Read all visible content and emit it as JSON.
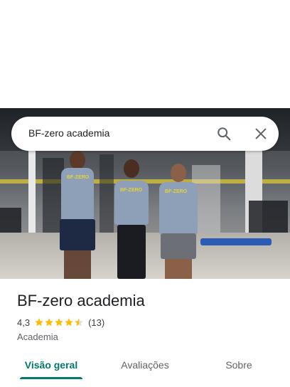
{
  "search": {
    "value": "BF-zero academia"
  },
  "photo": {
    "shirt_logo": "BF-ZERO"
  },
  "place": {
    "title": "BF-zero academia",
    "rating": "4,3",
    "stars": 4.5,
    "review_count": "(13)",
    "category": "Academia"
  },
  "tabs": [
    {
      "label": "Visão geral",
      "active": true
    },
    {
      "label": "Avaliações",
      "active": false
    },
    {
      "label": "Sobre",
      "active": false
    }
  ],
  "colors": {
    "accent": "#00796b",
    "star": "#fbbc04",
    "text": "#202124"
  },
  "icons": {
    "search": "search-icon",
    "close": "close-icon"
  }
}
